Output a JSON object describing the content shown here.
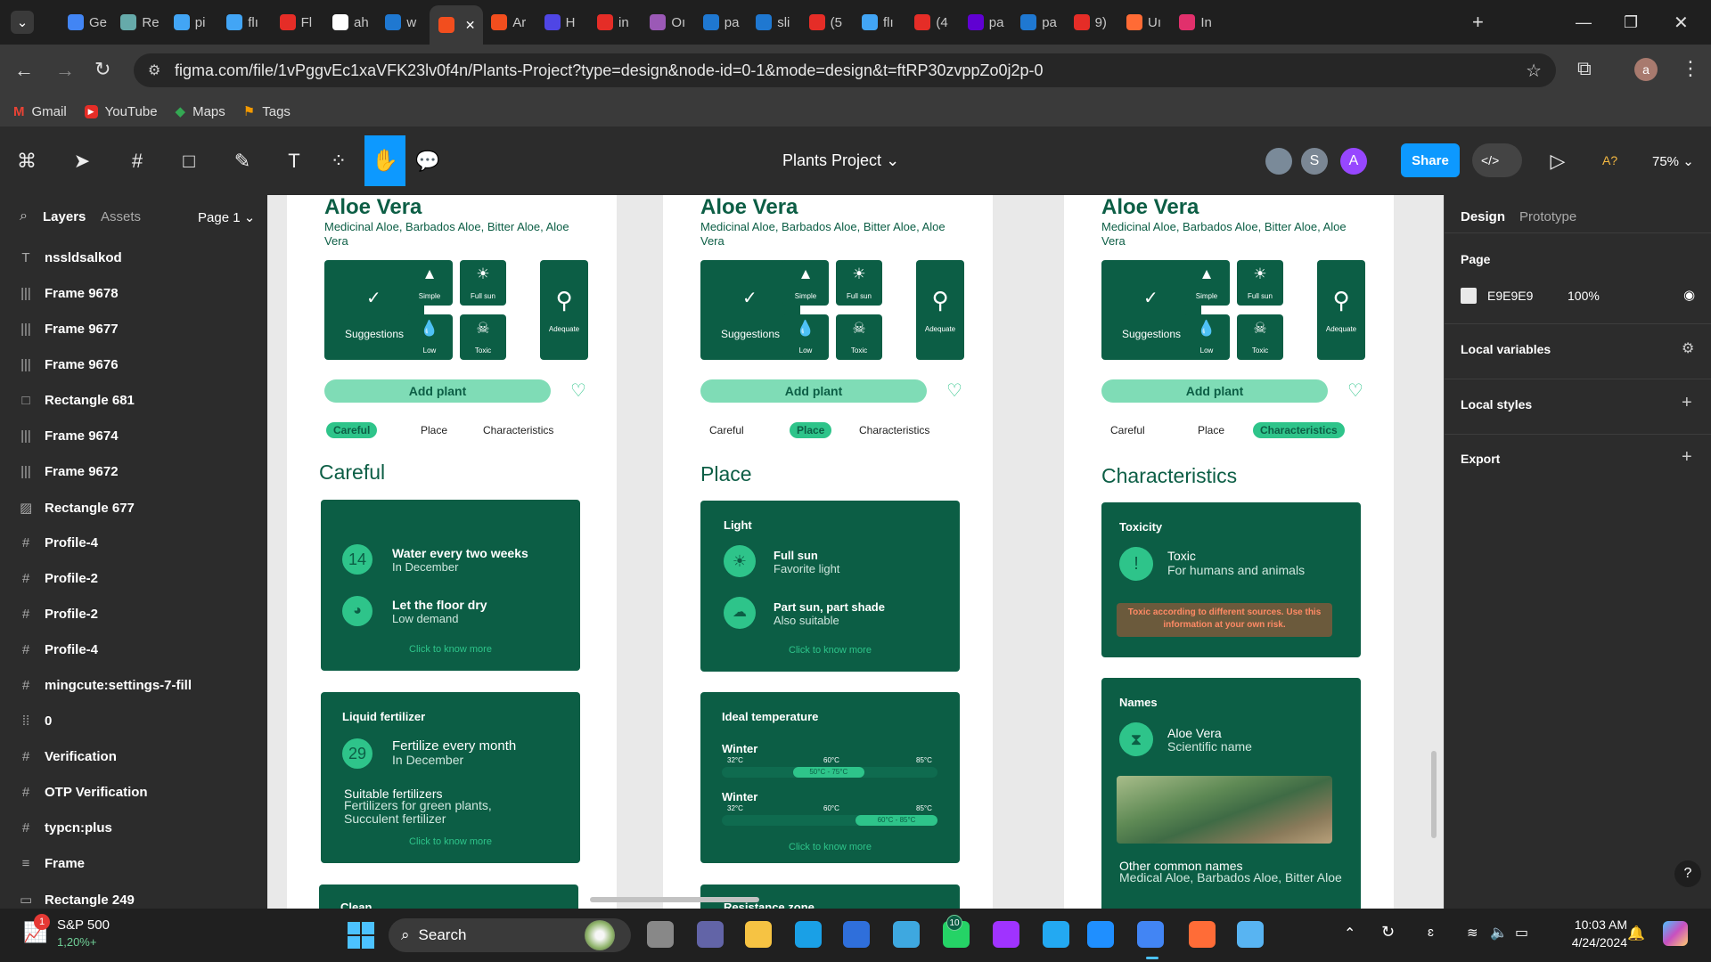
{
  "browser": {
    "tabs": [
      {
        "label": "Ge",
        "color": "#4285f4"
      },
      {
        "label": "Re",
        "color": "#6aa"
      },
      {
        "label": "pi",
        "color": "#42a5f5"
      },
      {
        "label": "flı",
        "color": "#42a5f5"
      },
      {
        "label": "Fl",
        "color": "#e52d27"
      },
      {
        "label": "ah",
        "color": "#ffffff"
      },
      {
        "label": "w",
        "color": "#1f78d1"
      },
      {
        "label": "",
        "color": "#f24e1e"
      },
      {
        "label": "Ar",
        "color": "#f24e1e"
      },
      {
        "label": "H",
        "color": "#4f46e5"
      },
      {
        "label": "in",
        "color": "#e52d27"
      },
      {
        "label": "Oı",
        "color": "#9b59b6"
      },
      {
        "label": "pa",
        "color": "#1f78d1"
      },
      {
        "label": "sli",
        "color": "#1f78d1"
      },
      {
        "label": "(5",
        "color": "#e52d27"
      },
      {
        "label": "flı",
        "color": "#42a5f5"
      },
      {
        "label": "(4",
        "color": "#e52d27"
      },
      {
        "label": "pa",
        "color": "#6001d2"
      },
      {
        "label": "pa",
        "color": "#1f78d1"
      },
      {
        "label": "9)",
        "color": "#e52d27"
      },
      {
        "label": "Uı",
        "color": "#ff6b35"
      },
      {
        "label": "In",
        "color": "#e1306c"
      }
    ],
    "url": "figma.com/file/1vPggvEc1xaVFK23lv0f4n/Plants-Project?type=design&node-id=0-1&mode=design&t=ftRP30zvppZo0j2p-0",
    "bookmarks": [
      "Gmail",
      "YouTube",
      "Maps",
      "Tags"
    ],
    "profile": "a"
  },
  "figma": {
    "project": "Plants Project",
    "share": "Share",
    "zoom": "75%",
    "avatars": [
      "S",
      "A"
    ],
    "left_tabs": {
      "layers": "Layers",
      "assets": "Assets",
      "page": "Page 1"
    },
    "layers": [
      {
        "icon": "T",
        "name": "nssldsalkod"
      },
      {
        "icon": "|||",
        "name": "Frame 9678"
      },
      {
        "icon": "|||",
        "name": "Frame 9677"
      },
      {
        "icon": "|||",
        "name": "Frame 9676"
      },
      {
        "icon": "□",
        "name": "Rectangle 681"
      },
      {
        "icon": "|||",
        "name": "Frame 9674"
      },
      {
        "icon": "|||",
        "name": "Frame 9672"
      },
      {
        "icon": "▨",
        "name": "Rectangle 677"
      },
      {
        "icon": "#",
        "name": "Profile-4"
      },
      {
        "icon": "#",
        "name": "Profile-2"
      },
      {
        "icon": "#",
        "name": "Profile-2"
      },
      {
        "icon": "#",
        "name": "Profile-4"
      },
      {
        "icon": "#",
        "name": "mingcute:settings-7-fill"
      },
      {
        "icon": "⁞⁞",
        "name": "0"
      },
      {
        "icon": "#",
        "name": "Verification"
      },
      {
        "icon": "#",
        "name": "OTP Verification"
      },
      {
        "icon": "#",
        "name": "typcn:plus"
      },
      {
        "icon": "≡",
        "name": "Frame"
      },
      {
        "icon": "▭",
        "name": "Rectangle 249"
      }
    ],
    "right": {
      "design": "Design",
      "prototype": "Prototype",
      "page": "Page",
      "page_color": "E9E9E9",
      "opacity": "100%",
      "local_variables": "Local variables",
      "local_styles": "Local styles",
      "export": "Export"
    }
  },
  "plant": {
    "name": "Aloe Vera",
    "aliases": "Medicinal Aloe, Barbados Aloe, Bitter Aloe, Aloe Vera",
    "suggestions": "Suggestions",
    "tiles": {
      "simple": "Simple",
      "full_sun": "Full sun",
      "low": "Low",
      "toxic": "Toxic",
      "adequate": "Adequate"
    },
    "add_plant": "Add plant",
    "tabs": {
      "careful": "Careful",
      "place": "Place",
      "characteristics": "Characteristics"
    },
    "know_more": "Click to know more"
  },
  "careful": {
    "title": "Careful",
    "water_num": "14",
    "water_title": "Water every two weeks",
    "water_sub": "In December",
    "floor_title": "Let the floor dry",
    "floor_sub": "Low demand",
    "fert_heading": "Liquid fertilizer",
    "fert_num": "29",
    "fert_title": "Fertilize every month",
    "fert_sub": "In December",
    "suitable": "Suitable fertilizers",
    "suitable_list": "Fertilizers for green plants, Succulent fertilizer",
    "next": "Clean"
  },
  "place": {
    "title": "Place",
    "light": "Light",
    "sun_title": "Full sun",
    "sun_sub": "Favorite light",
    "shade_title": "Part sun, part shade",
    "shade_sub": "Also suitable",
    "temp_heading": "Ideal temperature",
    "temps": [
      {
        "season": "Winter",
        "min": "32°C",
        "mid": "60°C",
        "max": "85°C",
        "range": "50°C - 75°C",
        "range_fraction": [
          0.33,
          0.66
        ]
      },
      {
        "season": "Winter",
        "min": "32°C",
        "mid": "60°C",
        "max": "85°C",
        "range": "60°C - 85°C",
        "range_fraction": [
          0.62,
          1.0
        ]
      }
    ],
    "next": "Resistance zone"
  },
  "chars": {
    "title": "Characteristics",
    "tox_heading": "Toxicity",
    "tox_title": "Toxic",
    "tox_sub": "For humans and animals",
    "warning": "Toxic according to different sources. Use this information at your own risk.",
    "names_heading": "Names",
    "sci_title": "Aloe Vera",
    "sci_sub": "Scientific name",
    "other": "Other common names",
    "other_list": "Medical Aloe, Barbados Aloe, Bitter Aloe"
  },
  "taskbar": {
    "stock": "S&P 500",
    "stock_change": "1,20%+",
    "search": "Search",
    "time": "10:03 AM",
    "date": "4/24/2024",
    "whatsapp_badge": "10",
    "stock_badge": "1"
  }
}
